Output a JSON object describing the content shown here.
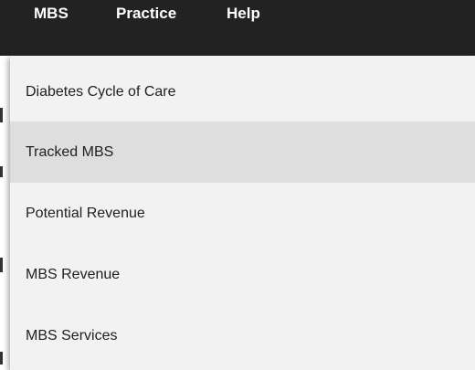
{
  "menubar": {
    "background": "#222222",
    "items": [
      {
        "label": "MBS"
      },
      {
        "label": "Practice"
      },
      {
        "label": "Help"
      }
    ]
  },
  "dropdown": {
    "parent_menu": "MBS",
    "highlighted_item": "Tracked MBS",
    "highlight_color": "#dedede",
    "items": [
      {
        "label": "Diabetes Cycle of Care"
      },
      {
        "label": "Tracked MBS"
      },
      {
        "label": "Potential Revenue"
      },
      {
        "label": "MBS Revenue"
      },
      {
        "label": "MBS Services"
      }
    ]
  }
}
